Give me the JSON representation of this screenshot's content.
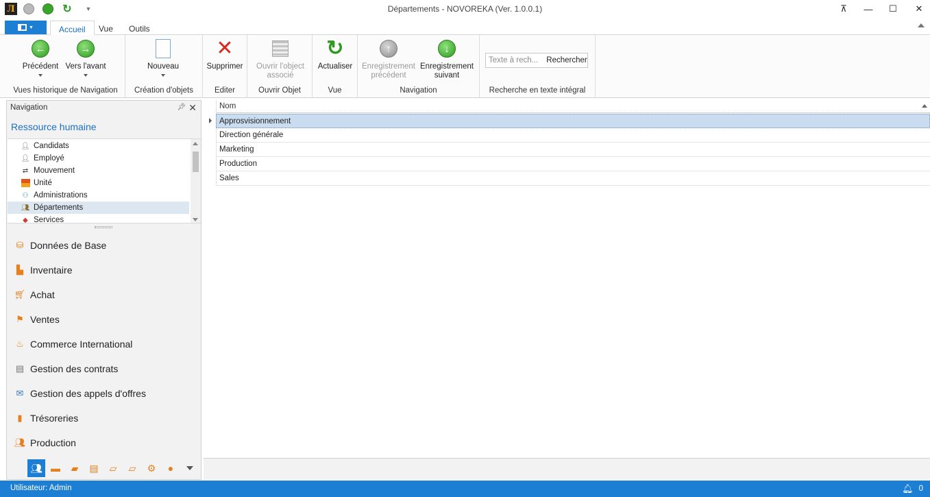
{
  "window": {
    "title": "Départements - NOVOREKA (Ver. 1.0.0.1)",
    "logo_letter": "Л",
    "controls": [
      "⊼",
      "—",
      "☐",
      "✕"
    ]
  },
  "ribbon_tabs": [
    {
      "label": "Accueil",
      "active": true
    },
    {
      "label": "Vue",
      "active": false
    },
    {
      "label": "Outils",
      "active": false
    }
  ],
  "ribbon": {
    "groups": {
      "history": {
        "label": "Vues historique de Navigation",
        "previous": "Précédent",
        "forward": "Vers l'avant"
      },
      "create": {
        "label": "Création d'objets",
        "new": "Nouveau"
      },
      "edit": {
        "label": "Editer",
        "delete": "Supprimer"
      },
      "open": {
        "label": "Ouvrir Objet",
        "open_line1": "Ouvrir l'object",
        "open_line2": "associé"
      },
      "view": {
        "label": "Vue",
        "refresh": "Actualiser"
      },
      "navigation": {
        "label": "Navigation",
        "prev_line1": "Enregistrement",
        "prev_line2": "précédent",
        "next_line1": "Enregistrement",
        "next_line2": "suivant"
      },
      "search": {
        "label": "Recherche en texte intégral",
        "placeholder": "Texte à rech...",
        "button": "Rechercher"
      }
    }
  },
  "navigation": {
    "header": "Navigation",
    "group_title": "Ressource humaine",
    "items": [
      {
        "label": "Candidats",
        "icon": "person-icon"
      },
      {
        "label": "Employé",
        "icon": "person-icon"
      },
      {
        "label": "Mouvement",
        "icon": "movement-icon"
      },
      {
        "label": "Unité",
        "icon": "unit-icon"
      },
      {
        "label": "Administrations",
        "icon": "administration-icon"
      },
      {
        "label": "Départements",
        "icon": "department-icon",
        "selected": true
      },
      {
        "label": "Services",
        "icon": "services-icon"
      }
    ],
    "groups": [
      {
        "label": "Données de Base",
        "icon": "database-icon"
      },
      {
        "label": "Inventaire",
        "icon": "forklift-icon"
      },
      {
        "label": "Achat",
        "icon": "cart-icon"
      },
      {
        "label": "Ventes",
        "icon": "sales-icon"
      },
      {
        "label": "Commerce International",
        "icon": "trade-icon"
      },
      {
        "label": "Gestion des contrats",
        "icon": "contract-icon"
      },
      {
        "label": "Gestion des appels d'offres",
        "icon": "tender-icon"
      },
      {
        "label": "Trésoreries",
        "icon": "treasury-icon"
      },
      {
        "label": "Production",
        "icon": "production-icon"
      }
    ]
  },
  "grid": {
    "column": "Nom",
    "rows": [
      "Approsvisionnement",
      "Direction générale",
      "Marketing",
      "Production",
      "Sales"
    ]
  },
  "status": {
    "user": "Utilisateur: Admin",
    "notifications": "0"
  },
  "colors": {
    "accent": "#1c7fd3",
    "selection": "#c9dcf0",
    "nav_icons": "#e6801e"
  }
}
